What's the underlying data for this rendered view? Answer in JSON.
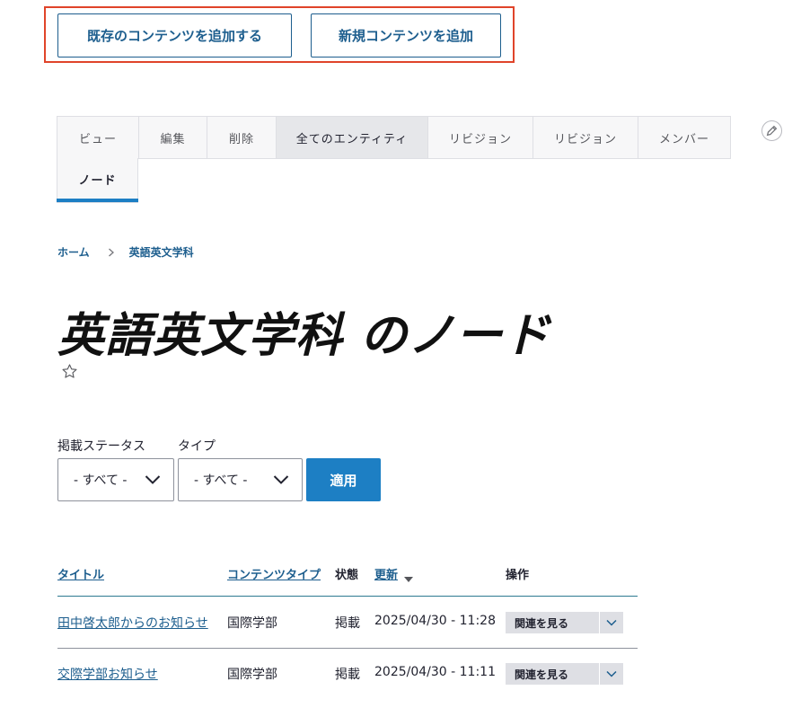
{
  "actions": {
    "add_existing": "既存のコンテンツを追加する",
    "add_new": "新規コンテンツを追加"
  },
  "tabs": {
    "primary": [
      "ビュー",
      "編集",
      "削除",
      "全てのエンティティ",
      "リビジョン",
      "リビジョン",
      "メンバー"
    ],
    "secondary": [
      "ノード"
    ]
  },
  "breadcrumb": {
    "home": "ホーム",
    "current": "英語英文学科"
  },
  "page": {
    "title": "英語英文学科 のノード"
  },
  "filters": {
    "status_label": "掲載ステータス",
    "status_value": "- すべて -",
    "type_label": "タイプ",
    "type_value": "- すべて -",
    "apply": "適用"
  },
  "table": {
    "headers": {
      "title": "タイトル",
      "content_type": "コンテンツタイプ",
      "status": "状態",
      "updated": "更新",
      "operations": "操作"
    },
    "rows": [
      {
        "title": "田中啓太郎からのお知らせ",
        "type": "国際学部",
        "status": "掲載",
        "updated": "2025/04/30 - 11:28",
        "op": "関連を見る"
      },
      {
        "title": "交際学部お知らせ",
        "type": "国際学部",
        "status": "掲載",
        "updated": "2025/04/30 - 11:11",
        "op": "関連を見る"
      }
    ]
  },
  "icons": {
    "edit": "pencil-icon",
    "favorite": "star-icon",
    "sort": "sort-desc-icon",
    "dropdown": "chevron-down-icon"
  },
  "colors": {
    "accent": "#1d7fc4",
    "link": "#1d5e8e",
    "highlight_border": "#e0442a"
  }
}
